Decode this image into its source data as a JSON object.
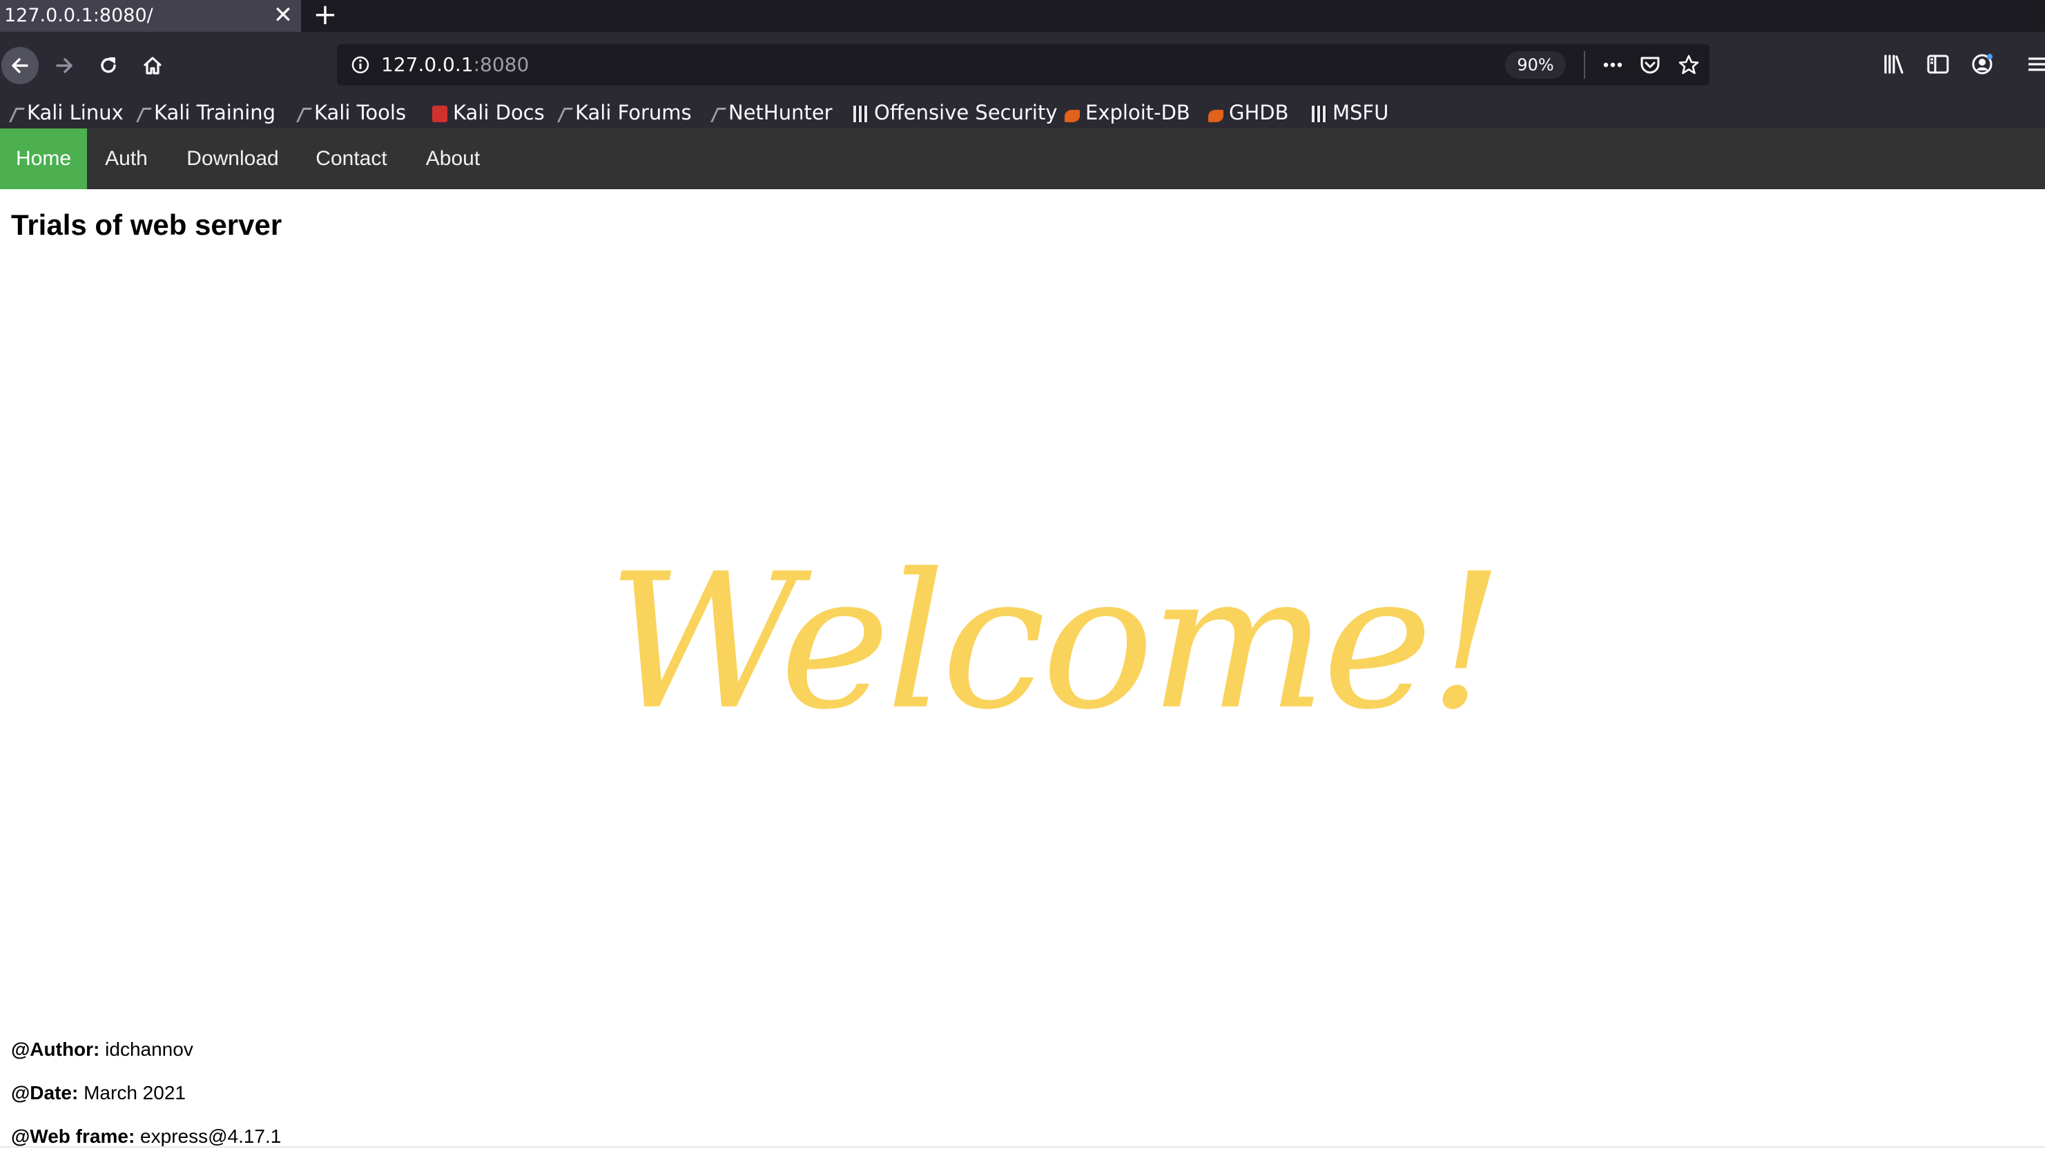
{
  "browser": {
    "tab_title": "127.0.0.1:8080/",
    "tab_close": "✕",
    "new_tab": "+",
    "url_host": "127.0.0.1",
    "url_port": ":8080",
    "zoom": "90%",
    "bookmarks": [
      "Kali Linux",
      "Kali Training",
      "Kali Tools",
      "Kali Docs",
      "Kali Forums",
      "NetHunter",
      "Offensive Security",
      "Exploit-DB",
      "GHDB",
      "MSFU"
    ]
  },
  "site": {
    "nav": [
      "Home",
      "Auth",
      "Download",
      "Contact",
      "About"
    ],
    "active_nav": "Home",
    "title": "Trials of web server",
    "welcome": "Welcome!",
    "meta": {
      "author_label": "@Author:",
      "author": "idchannov",
      "date_label": "@Date:",
      "date": "March 2021",
      "frame_label": "@Web frame:",
      "frame": "express@4.17.1"
    }
  },
  "colors": {
    "nav_active": "#4caf50",
    "nav_bg": "#333333",
    "welcome": "#f9d35c",
    "chrome": "#2b2a33"
  }
}
